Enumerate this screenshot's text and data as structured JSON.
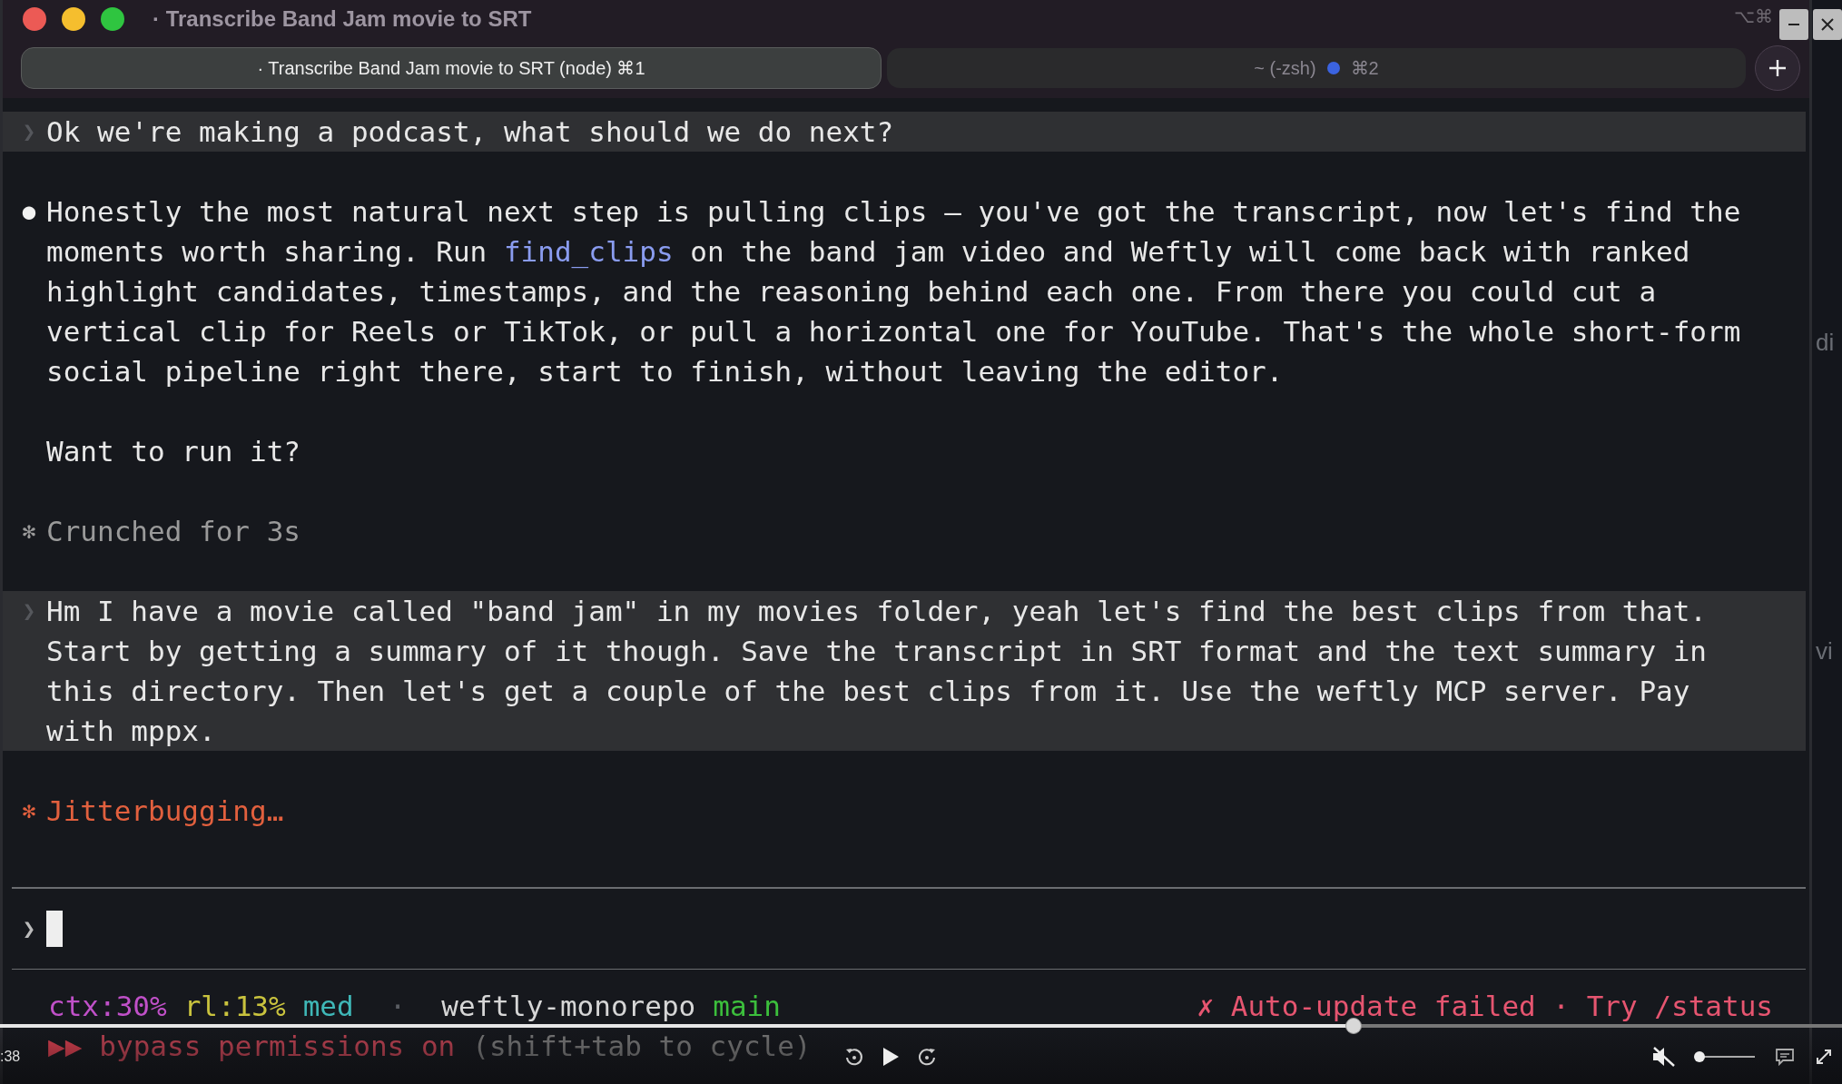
{
  "window": {
    "title": "· Transcribe Band Jam movie to SRT",
    "shortcut_hint": "⌥⌘"
  },
  "tabs": [
    {
      "label": "· Transcribe Band Jam movie to SRT (node) ⌘1",
      "selected": true
    },
    {
      "label": "~ (-zsh)",
      "shortcut": "⌘2",
      "selected": false,
      "color": "#3b63e0"
    }
  ],
  "transcript": [
    {
      "kind": "user",
      "marker": "❯",
      "text": "Ok we're making a podcast, what should we do next?"
    },
    {
      "kind": "assistant",
      "marker": "●",
      "segments": [
        {
          "text": "Honestly the most natural next step is pulling clips — you've got the transcript, now let's find the moments worth sharing. Run "
        },
        {
          "text": "find_clips",
          "kind": "code"
        },
        {
          "text": " on the band jam video and Weftly will come back with ranked highlight candidates, timestamps, and the reasoning behind each one. From there you could cut a vertical clip for Reels or TikTok, or pull a horizontal one for YouTube. That's the whole short-form social pipeline right there, start to finish, without leaving the editor."
        }
      ]
    },
    {
      "kind": "assistant",
      "segments": [
        {
          "text": "Want to run it?"
        }
      ]
    },
    {
      "kind": "status",
      "marker": "✻",
      "text": "Crunched for 3s"
    },
    {
      "kind": "user",
      "marker": "❯",
      "text": "Hm I have a movie called \"band jam\" in my movies folder, yeah let's find the best clips from that. Start by getting a summary of it though. Save the transcript in SRT format and the text summary in this directory. Then let's get a couple of the best clips from it. Use the weftly MCP server. Pay with mppx."
    },
    {
      "kind": "spinner",
      "marker": "✻",
      "text": "Jitterbugging…"
    }
  ],
  "prompt": {
    "marker": "❯"
  },
  "status_line": {
    "items": [
      {
        "text": "ctx:30%",
        "color": "#c050c8"
      },
      {
        "text": "rl:13%",
        "color": "#c9c33e"
      },
      {
        "text": "med",
        "color": "#3fb8b8"
      },
      {
        "text": "·",
        "color": "#5a5d63"
      },
      {
        "text": "weftly-monorepo",
        "color": "#d6d6d6"
      },
      {
        "text": "main",
        "color": "#3cbf3c"
      }
    ],
    "warning": "✗ Auto-update failed · Try /status"
  },
  "mode_line": {
    "marker": "▶▶",
    "label": "bypass permissions on",
    "hint": "(shift+tab to cycle)"
  },
  "background_window": {
    "texts": [
      "di",
      "vi"
    ]
  },
  "player": {
    "time": ":38",
    "level": 0.735,
    "muted": true,
    "volume": {
      "level": 0.0
    }
  }
}
